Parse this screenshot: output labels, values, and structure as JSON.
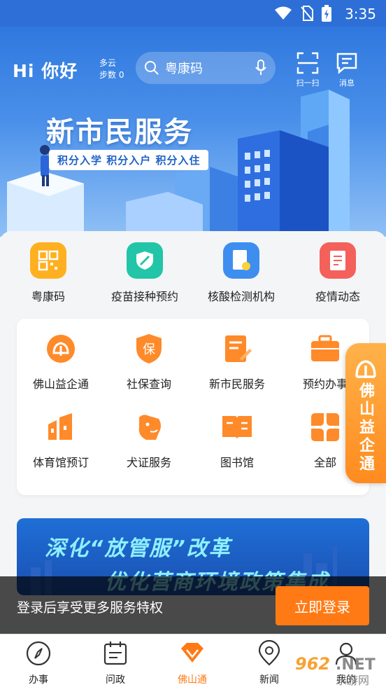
{
  "status_bar": {
    "time": "3:35"
  },
  "header": {
    "greeting": "Hi 你好",
    "weather": "多云",
    "steps": "步数 0",
    "search_text": "粤康码",
    "scan_label": "扫一扫",
    "message_label": "消息"
  },
  "banner_top": {
    "title": "新市民服务",
    "subtitle": "积分入学 积分入户 积分入住"
  },
  "quick_services": [
    {
      "label": "粤康码",
      "icon": "qr-code-icon",
      "color": "#ffb020"
    },
    {
      "label": "疫苗接种预约",
      "icon": "vaccine-icon",
      "color": "#22c5a8"
    },
    {
      "label": "核酸检测机构",
      "icon": "nucleic-test-icon",
      "color": "#3e8ef0"
    },
    {
      "label": "疫情动态",
      "icon": "epidemic-news-icon",
      "color": "#f4605a"
    }
  ],
  "services": [
    {
      "label": "佛山益企通",
      "icon": "enterprise-icon"
    },
    {
      "label": "社保查询",
      "icon": "social-security-icon"
    },
    {
      "label": "新市民服务",
      "icon": "new-citizen-icon"
    },
    {
      "label": "预约办事",
      "icon": "appointment-icon"
    },
    {
      "label": "体育馆预订",
      "icon": "stadium-icon"
    },
    {
      "label": "犬证服务",
      "icon": "dog-license-icon"
    },
    {
      "label": "图书馆",
      "icon": "library-icon"
    },
    {
      "label": "全部",
      "icon": "all-icon"
    }
  ],
  "float_tab": {
    "label": "佛山益企通"
  },
  "banner_bottom": {
    "line1": "深化“放管服”改革",
    "line2": "优化营商环境政策集成"
  },
  "login_bar": {
    "text": "登录后享受更多服务特权",
    "button": "立即登录"
  },
  "tabs": [
    {
      "label": "办事",
      "icon": "compass-icon",
      "active": false
    },
    {
      "label": "问政",
      "icon": "calendar-icon",
      "active": false
    },
    {
      "label": "佛山通",
      "icon": "diamond-icon",
      "active": true
    },
    {
      "label": "新闻",
      "icon": "location-icon",
      "active": false
    },
    {
      "label": "我的",
      "icon": "user-icon",
      "active": false
    }
  ],
  "watermark": {
    "text": "962.NET 乐游网"
  },
  "colors": {
    "primary_blue": "#2d6fd6",
    "accent_orange": "#ff7a14"
  }
}
